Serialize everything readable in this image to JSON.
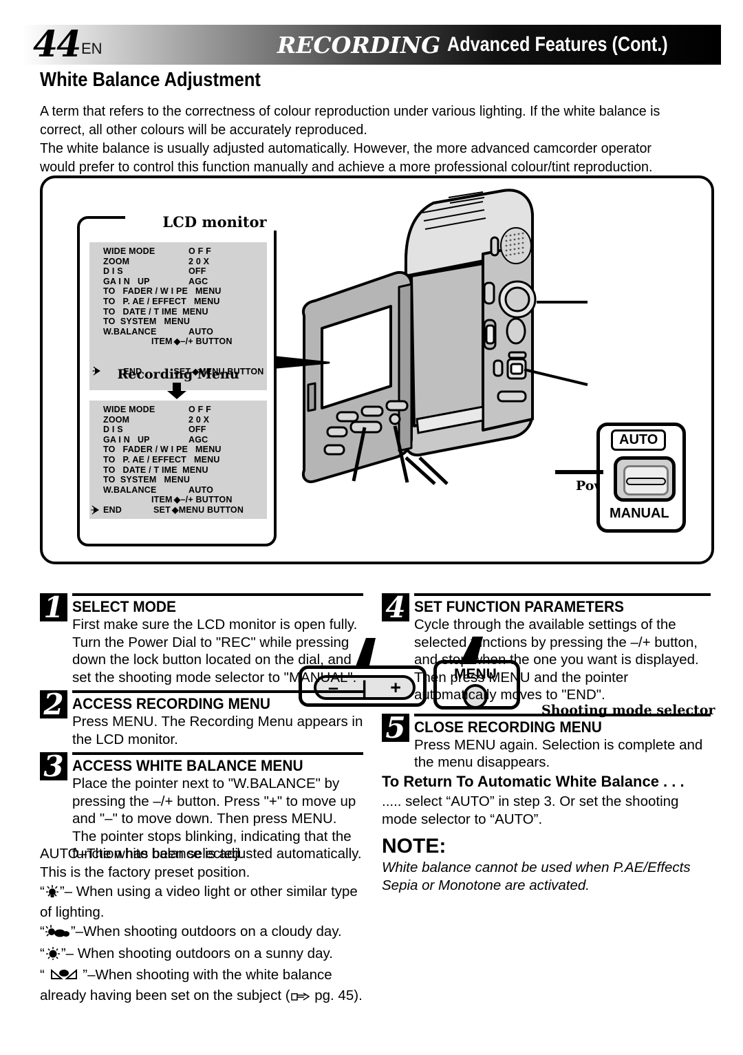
{
  "header": {
    "page_number": "44",
    "language_code": "EN",
    "kicker": "RECORDING",
    "subtitle": "Advanced Features (Cont.)"
  },
  "section_title": "White Balance Adjustment",
  "intro": {
    "paragraph1": "A term that refers to the correctness of colour reproduction under various lighting. If the white balance is correct, all other colours will be accurately reproduced.",
    "paragraph2": "The white balance is usually adjusted automatically. However, the more advanced camcorder operator would prefer to control this function manually and achieve a more professional colour/tint reproduction."
  },
  "diagram": {
    "lcd_monitor_label": "LCD monitor",
    "recording_menu_label": "Recording Menu",
    "callouts": {
      "power_dial": "Power Dial",
      "shooting_mode_selector": "Shooting mode selector",
      "menu_button": "MENU",
      "mode_auto": "AUTO",
      "mode_manual": "MANUAL",
      "minus": "–",
      "bar": "|",
      "plus": "+"
    },
    "osd_top": {
      "pointer_at": "END",
      "rows": [
        {
          "label": "WIDE MODE",
          "value": "O F F"
        },
        {
          "label": "ZOOM",
          "value": "2 0 X"
        },
        {
          "label": "D I S",
          "value": "OFF"
        },
        {
          "label": "GA I N   UP",
          "value": "AGC"
        },
        {
          "label": "TO   FADER / W I PE   MENU",
          "value": ""
        },
        {
          "label": "TO   P. AE / EFFECT   MENU",
          "value": ""
        },
        {
          "label": "TO   DATE / T IME  MENU",
          "value": ""
        },
        {
          "label": "TO  SYSTEM   MENU",
          "value": ""
        },
        {
          "label": "W.BALANCE",
          "value": "AUTO"
        }
      ],
      "footer1_label": "ITEM",
      "footer1_value": "–/+ BUTTON",
      "footer2_label": "END",
      "footer2_mid": "SET",
      "footer2_value": "MENU BUTTON"
    },
    "osd_bottom": {
      "pointer_at": "W.BALANCE",
      "rows": [
        {
          "label": "WIDE MODE",
          "value": "O F F"
        },
        {
          "label": "ZOOM",
          "value": "2 0 X"
        },
        {
          "label": "D I S",
          "value": "OFF"
        },
        {
          "label": "GA I N   UP",
          "value": "AGC"
        },
        {
          "label": "TO   FADER / W I PE   MENU",
          "value": ""
        },
        {
          "label": "TO   P. AE / EFFECT   MENU",
          "value": ""
        },
        {
          "label": "TO   DATE / T IME  MENU",
          "value": ""
        },
        {
          "label": "TO  SYSTEM   MENU",
          "value": ""
        },
        {
          "label": "W.BALANCE",
          "value": "AUTO"
        }
      ],
      "footer1_label": "ITEM",
      "footer1_value": "–/+ BUTTON",
      "footer2_label": "END",
      "footer2_mid": "SET",
      "footer2_value": "MENU BUTTON"
    }
  },
  "steps": [
    {
      "number": "1",
      "title": "SELECT MODE",
      "text": "First make sure the LCD monitor is open fully. Turn the Power Dial to \"REC\" while pressing down the lock button located on the dial, and set the shooting mode selector to \"MANUAL\"."
    },
    {
      "number": "2",
      "title": "ACCESS RECORDING MENU",
      "text": "Press MENU. The Recording Menu appears in the LCD monitor."
    },
    {
      "number": "3",
      "title": "ACCESS WHITE BALANCE MENU",
      "text": "Place the pointer next to \"W.BALANCE\" by pressing the –/+ button. Press \"+\" to move up and \"–\" to move down. Then press MENU. The pointer stops blinking, indicating that the function has been selected."
    },
    {
      "number": "4",
      "title": "SET FUNCTION PARAMETERS",
      "text": "Cycle through the available settings of the selected functions by pressing the –/+ button, and stop when the one you want is displayed. Then press MENU and the pointer automatically moves to \"END\"."
    },
    {
      "number": "5",
      "title": "CLOSE RECORDING MENU",
      "text": "Press MENU again. Selection is complete and the menu disappears."
    }
  ],
  "left_notes": {
    "auto_line": "AUTO–The white balance is adjusted automatically. This is the factory preset position.",
    "symbols": [
      {
        "icon": "video-light-icon",
        "text": "–  When using a video light or other similar type of lighting."
      },
      {
        "icon": "cloudy-icon",
        "text": "–When shooting outdoors on a cloudy day."
      },
      {
        "icon": "sunny-icon",
        "text": "–  When shooting outdoors on a sunny day."
      },
      {
        "icon": "manual-wb-icon",
        "text": "–When shooting with the white balance already having been set on the subject ("
      }
    ],
    "page_ref_suffix": " pg. 45)."
  },
  "right_notes": {
    "return_title": "To Return To Automatic White Balance . . .",
    "return_text": "..... select “AUTO” in step 3. Or set the shooting mode selector to “AUTO”.",
    "note_heading": "NOTE:",
    "note_text": "White balance cannot be used when P.AE/Effects Sepia or Monotone are activated."
  }
}
